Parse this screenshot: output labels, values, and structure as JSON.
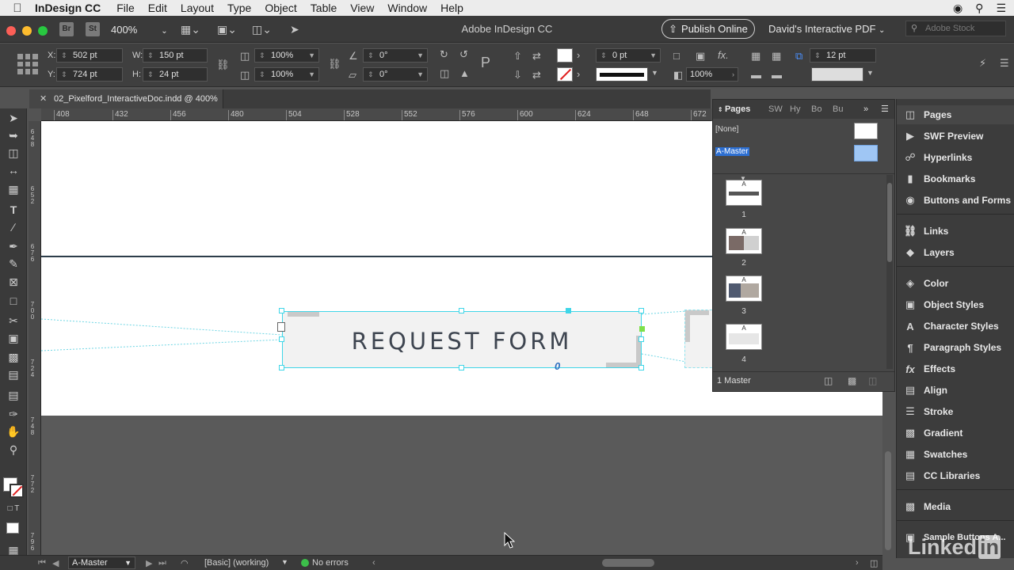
{
  "menubar": {
    "app_name": "InDesign CC",
    "items": [
      "File",
      "Edit",
      "Layout",
      "Type",
      "Object",
      "Table",
      "View",
      "Window",
      "Help"
    ]
  },
  "appbar": {
    "zoom": "400%",
    "title": "Adobe InDesign CC",
    "publish_label": "Publish Online",
    "workspace": "David's Interactive PDF",
    "stock_placeholder": "Adobe Stock"
  },
  "control": {
    "x_label": "X:",
    "x_value": "502 pt",
    "y_label": "Y:",
    "y_value": "724 pt",
    "w_label": "W:",
    "w_value": "150 pt",
    "h_label": "H:",
    "h_value": "24 pt",
    "scale_x": "100%",
    "scale_y": "100%",
    "angle": "0°",
    "shear": "0°",
    "stroke_weight": "0 pt",
    "opacity": "100%",
    "gap": "12 pt"
  },
  "document_tab": {
    "title": "02_Pixelford_InteractiveDoc.indd @ 400%"
  },
  "ruler": {
    "h_ticks": [
      "408",
      "432",
      "456",
      "480",
      "504",
      "528",
      "552",
      "576",
      "600",
      "624",
      "648",
      "672"
    ],
    "v_ticks": [
      "6 4 8",
      "6 5 2",
      "6 7 6",
      "7 0 0",
      "7 2 4",
      "7 4 8",
      "7 7 2",
      "7 9 6"
    ]
  },
  "canvas": {
    "button_label": "REQUEST FORM",
    "button_marker": "0"
  },
  "pages_panel": {
    "tabs": [
      "Pages",
      "SW",
      "Hy",
      "Bo",
      "Bu"
    ],
    "masters": [
      "[None]",
      "A-Master"
    ],
    "pages": [
      {
        "label": "A",
        "number": "1"
      },
      {
        "label": "A",
        "number": "2"
      },
      {
        "label": "A",
        "number": "3"
      },
      {
        "label": "A",
        "number": "4"
      }
    ],
    "footer": "1 Master"
  },
  "dock": {
    "items": [
      {
        "label": "Pages",
        "icon": "pages-icon"
      },
      {
        "label": "SWF Preview",
        "icon": "swf-icon"
      },
      {
        "label": "Hyperlinks",
        "icon": "hyperlinks-icon"
      },
      {
        "label": "Bookmarks",
        "icon": "bookmark-icon"
      },
      {
        "label": "Buttons and Forms",
        "icon": "buttons-icon"
      },
      {
        "label": "Links",
        "icon": "links-icon"
      },
      {
        "label": "Layers",
        "icon": "layers-icon"
      },
      {
        "label": "Color",
        "icon": "color-icon"
      },
      {
        "label": "Object Styles",
        "icon": "object-styles-icon"
      },
      {
        "label": "Character Styles",
        "icon": "character-styles-icon"
      },
      {
        "label": "Paragraph Styles",
        "icon": "paragraph-styles-icon"
      },
      {
        "label": "Effects",
        "icon": "effects-icon"
      },
      {
        "label": "Align",
        "icon": "align-icon"
      },
      {
        "label": "Stroke",
        "icon": "stroke-icon"
      },
      {
        "label": "Gradient",
        "icon": "gradient-icon"
      },
      {
        "label": "Swatches",
        "icon": "swatches-icon"
      },
      {
        "label": "CC Libraries",
        "icon": "cc-libraries-icon"
      },
      {
        "label": "Media",
        "icon": "media-icon"
      },
      {
        "label": "Sample Buttons A...",
        "icon": "sample-buttons-icon"
      }
    ]
  },
  "statusbar": {
    "master": "A-Master",
    "style": "[Basic] (working)",
    "errors": "No errors"
  },
  "watermark": {
    "text": "Linked",
    "suffix": "in"
  },
  "colors": {
    "selection": "#3fd6e8",
    "accent_blue": "#2f6fc0",
    "no_errors": "#3cbf4a"
  }
}
